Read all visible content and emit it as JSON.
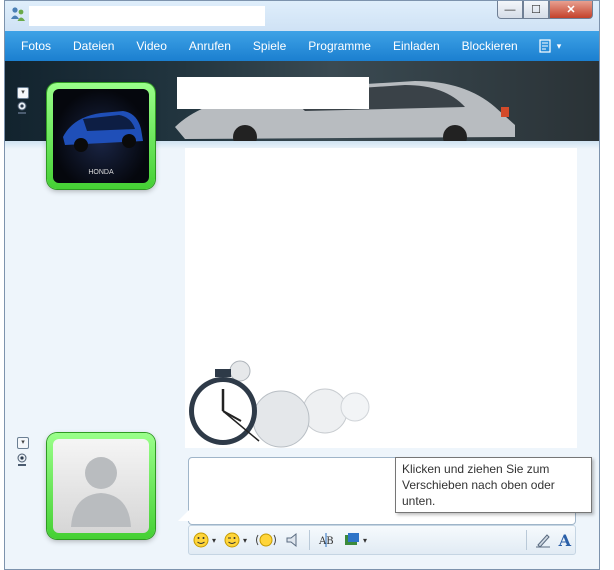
{
  "menu": {
    "items": [
      "Fotos",
      "Dateien",
      "Video",
      "Anrufen",
      "Spiele",
      "Programme",
      "Einladen",
      "Blockieren"
    ]
  },
  "window_controls": {
    "minimize": "—",
    "maximize": "☐",
    "close": "✕"
  },
  "icons": {
    "app": "messenger-icon",
    "menu_more": "menu-options-icon",
    "emoticon": "emoticon-icon",
    "wink": "wink-icon",
    "nudge": "nudge-icon",
    "voice_clip": "voice-clip-icon",
    "font": "font-icon",
    "background": "background-icon",
    "handwriting": "handwriting-icon",
    "text_format": "text-format-icon"
  },
  "contact_picture": {
    "brand_label": "HONDA"
  },
  "tooltip": {
    "text": "Klicken und ziehen Sie zum Verschieben nach oben oder unten."
  },
  "toolbar": {
    "dropdown_arrow": "▾",
    "font_label": "A"
  },
  "colors": {
    "menubar": "#1b7fd0",
    "avatar_frame": "#45d034",
    "close_button": "#c4412a"
  }
}
